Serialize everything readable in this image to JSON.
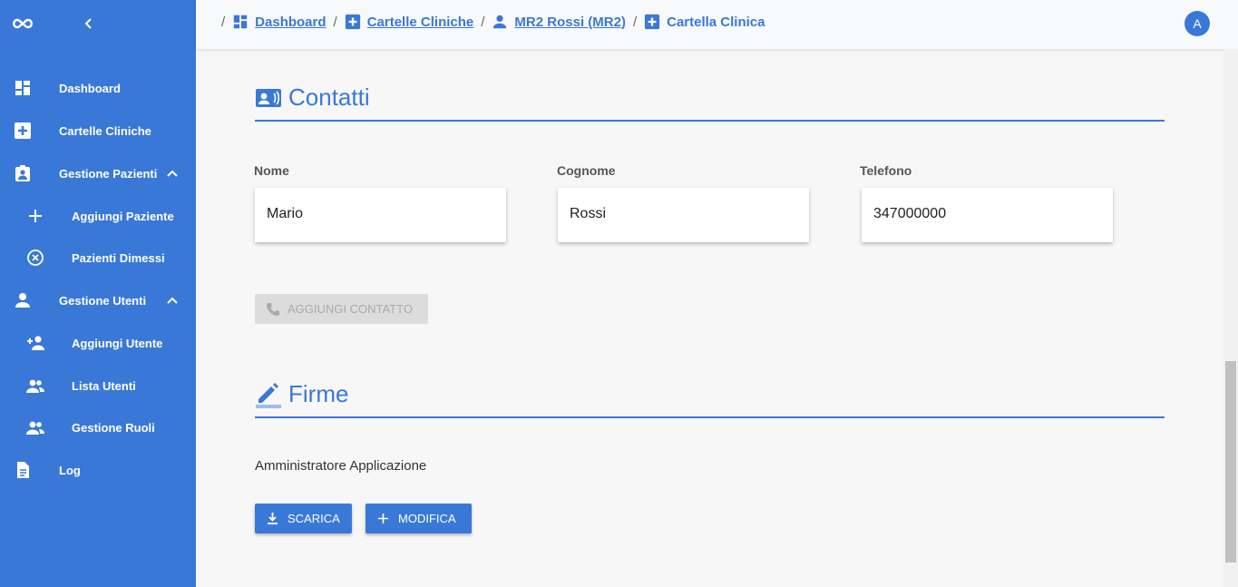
{
  "colors": {
    "accent": "#3a78d8",
    "sidebar_bg": "#3a78d8",
    "content_bg": "#f7f7f7"
  },
  "sidebar": {
    "logo_icon": "infinity-icon",
    "collapse_icon": "chevron-left-icon",
    "items": [
      {
        "label": "Dashboard",
        "icon": "dashboard-icon"
      },
      {
        "label": "Cartelle Cliniche",
        "icon": "medical-plus-icon"
      },
      {
        "label": "Gestione Pazienti",
        "icon": "clipboard-user-icon"
      },
      {
        "label": "Aggiungi Paziente",
        "icon": "plus-icon"
      },
      {
        "label": "Pazienti Dimessi",
        "icon": "circle-x-icon"
      },
      {
        "label": "Gestione Utenti",
        "icon": "person-icon"
      },
      {
        "label": "Aggiungi Utente",
        "icon": "person-add-icon"
      },
      {
        "label": "Lista Utenti",
        "icon": "people-icon"
      },
      {
        "label": "Gestione Ruoli",
        "icon": "people-icon"
      },
      {
        "label": "Log",
        "icon": "document-icon"
      }
    ]
  },
  "breadcrumb": {
    "items": [
      {
        "label": "Dashboard",
        "icon": "dashboard-icon"
      },
      {
        "label": "Cartelle Cliniche",
        "icon": "medical-plus-icon"
      },
      {
        "label": "MR2 Rossi (MR2)",
        "icon": "person-icon"
      },
      {
        "label": "Cartella Clinica",
        "icon": "medical-plus-icon"
      }
    ]
  },
  "user": {
    "avatar_letter": "A"
  },
  "contatti": {
    "title": "Contatti",
    "fields": [
      {
        "label": "Nome",
        "value": "Mario"
      },
      {
        "label": "Cognome",
        "value": "Rossi"
      },
      {
        "label": "Telefono",
        "value": "347000000"
      }
    ],
    "add_button": "AGGIUNGI CONTATTO"
  },
  "firme": {
    "title": "Firme",
    "signer": "Amministratore Applicazione",
    "download_button": "SCARICA",
    "edit_button": "MODIFICA"
  }
}
